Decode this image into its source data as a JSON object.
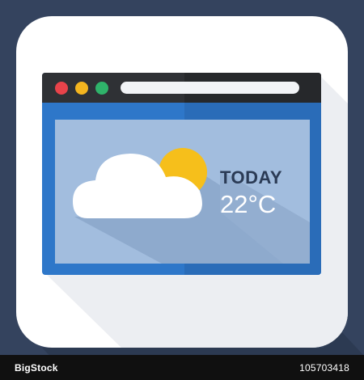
{
  "icon": {
    "window": {
      "url_value": ""
    },
    "weather": {
      "label": "TODAY",
      "temperature": "22°C",
      "condition": "partly-cloudy"
    },
    "colors": {
      "background": "#34435e",
      "tile": "#ffffff",
      "window_frame": "#2e77c9",
      "screen": "#a2bdde",
      "titlebar": "#2f3135",
      "close": "#e8434a",
      "minimize": "#f4b51f",
      "maximize": "#2fb36a",
      "sun": "#f6bf1b",
      "cloud": "#ffffff"
    }
  },
  "watermark": {
    "brand": "BigStock",
    "image_id": "105703418"
  }
}
